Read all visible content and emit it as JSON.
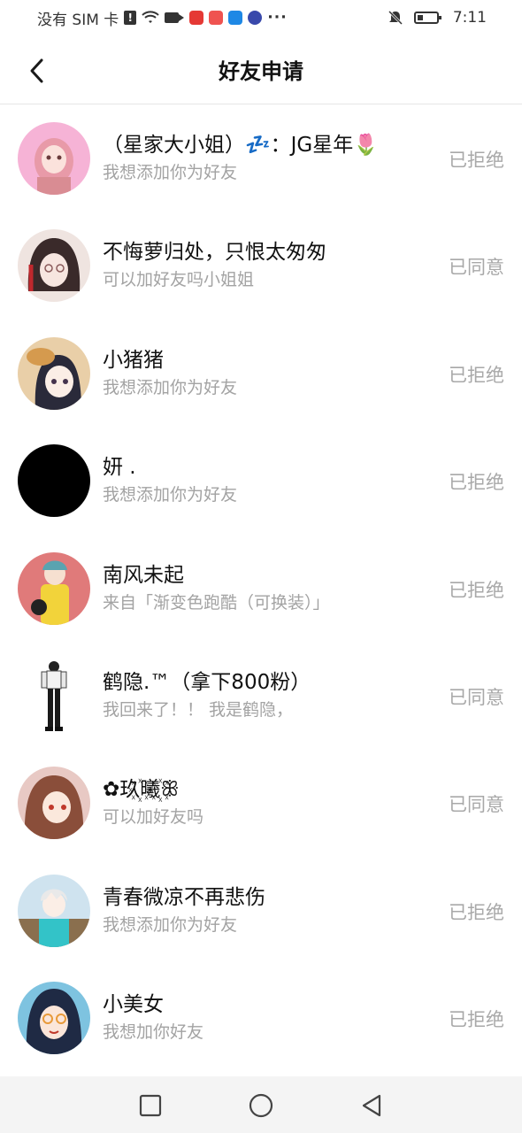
{
  "status_bar": {
    "carrier": "没有 SIM 卡",
    "time": "7:11",
    "more": "···",
    "icons": [
      "alert-icon",
      "wifi-icon",
      "video-icon",
      "app-icon-red",
      "app-icon-red2",
      "cloud-icon",
      "music-icon",
      "mute-bell-icon",
      "battery-icon"
    ]
  },
  "header": {
    "title": "好友申请",
    "back_icon": "chevron-left-icon"
  },
  "requests": [
    {
      "name": "（星家大小姐）💤：JG星年🌷",
      "message": "我想添加你为好友",
      "status": "已拒绝"
    },
    {
      "name": "不悔萝归处，只恨太匆匆",
      "message": "可以加好友吗小姐姐",
      "status": "已同意"
    },
    {
      "name": "小猪猪",
      "message": "我想添加你为好友",
      "status": "已拒绝"
    },
    {
      "name": "妍 .",
      "message": "我想添加你为好友",
      "status": "已拒绝"
    },
    {
      "name": "南风未起",
      "message": "来自「渐变色跑酷（可换装）」",
      "status": "已拒绝"
    },
    {
      "name": "鹤隐.™（拿下800粉）",
      "message": "我回来了！！ 我是鹤隐，",
      "status": "已同意"
    },
    {
      "name": "✿玖꙰曦꙰ꕥ",
      "message": "可以加好友吗",
      "status": "已同意"
    },
    {
      "name": "青春微凉不再悲伤",
      "message": "我想添加你为好友",
      "status": "已拒绝"
    },
    {
      "name": "小美女",
      "message": "我想加你好友",
      "status": "已拒绝"
    }
  ],
  "nav": {
    "icons": [
      "recent-apps-icon",
      "home-icon",
      "back-triangle-icon"
    ]
  },
  "colors": {
    "status_text": "#a8a8a8",
    "secondary_text": "#a3a3a3",
    "nav_bg": "#f4f4f4"
  }
}
